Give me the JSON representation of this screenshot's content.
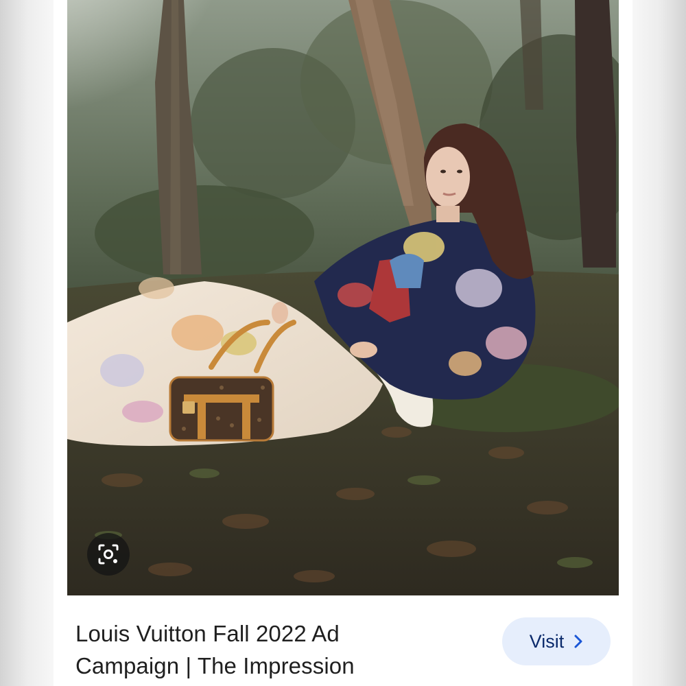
{
  "result": {
    "image": {
      "alt": "Woman in a floral sweater reclining against a tree in a forest with a monogram handbag"
    },
    "lens_icon": "visual-search-icon",
    "title": "Louis Vuitton Fall 2022 Ad Campaign | The Impression",
    "visit_button": {
      "label": "Visit",
      "icon": "chevron-right-icon"
    }
  },
  "colors": {
    "visit_bg": "#e6eefc",
    "visit_text": "#0b2a6b",
    "caption_text": "#1f1f1f"
  }
}
